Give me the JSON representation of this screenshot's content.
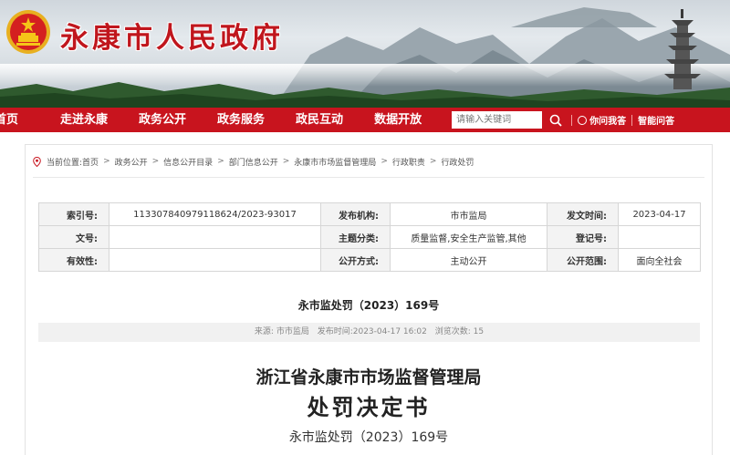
{
  "header": {
    "site_title": "永康市人民政府"
  },
  "nav": {
    "items": [
      "首页",
      "走进永康",
      "政务公开",
      "政务服务",
      "政民互动",
      "数据开放"
    ],
    "search_placeholder": "请输入关键词",
    "ask_label": "你问我答",
    "smart_label": "智能问答"
  },
  "breadcrumb": {
    "prefix": "当前位置:",
    "items": [
      "首页",
      "政务公开",
      "信息公开目录",
      "部门信息公开",
      "永康市市场监督管理局",
      "行政职责",
      "行政处罚"
    ]
  },
  "meta": {
    "index_label": "索引号:",
    "index_value": "113307840979118624/2023-93017",
    "publisher_label": "发布机构:",
    "publisher_value": "市市监局",
    "publish_date_label": "发文时间:",
    "publish_date_value": "2023-04-17",
    "doc_no_label": "文号:",
    "doc_no_value": "",
    "topic_label": "主题分类:",
    "topic_value": "质量监督,安全生产监管,其他",
    "reg_no_label": "登记号:",
    "reg_no_value": "",
    "validity_label": "有效性:",
    "validity_value": "",
    "open_mode_label": "公开方式:",
    "open_mode_value": "主动公开",
    "open_scope_label": "公开范围:",
    "open_scope_value": "面向全社会"
  },
  "article": {
    "doc_number": "永市监处罚（2023）169号",
    "source": "来源: 市市监局",
    "publish_time": "发布时间:2023-04-17  16:02",
    "views": "浏览次数: 15",
    "org_line": "浙江省永康市市场监督管理局",
    "title": "处罚决定书",
    "doc_number_body": "永市监处罚（2023）169号"
  },
  "colors": {
    "brand_red": "#c8141e",
    "title_red": "#c0161d"
  }
}
